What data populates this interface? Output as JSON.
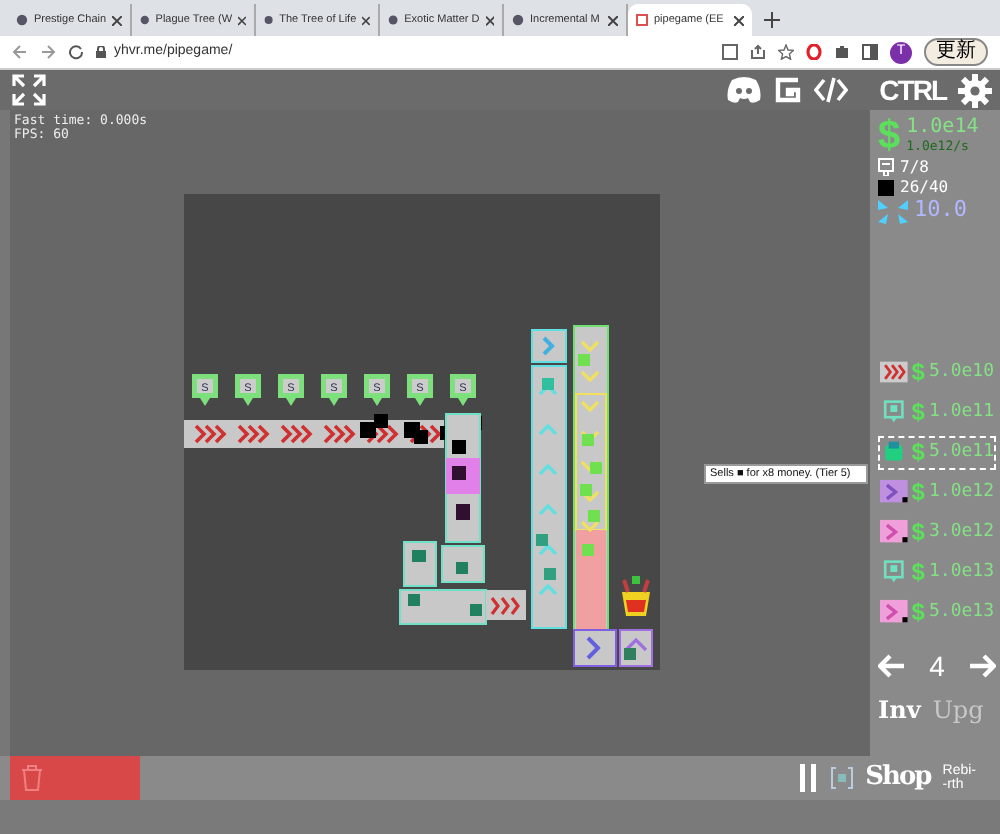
{
  "browser": {
    "tabs": [
      {
        "title": "Prestige Chain",
        "selected": false
      },
      {
        "title": "Plague Tree (W",
        "selected": false
      },
      {
        "title": "The Tree of Life",
        "selected": false
      },
      {
        "title": "Exotic Matter D",
        "selected": false
      },
      {
        "title": "Incremental M",
        "selected": false
      },
      {
        "title": "pipegame (EE",
        "selected": true
      }
    ],
    "url": "yhvr.me/pipegame/",
    "profile": "T",
    "update_button": "更新"
  },
  "topbar": {
    "ctrl_label": "CTRL"
  },
  "debug": {
    "fast_time": "Fast time: 0.000s",
    "fps": "FPS: 60"
  },
  "board": {
    "seller_labels": [
      "S",
      "S",
      "S",
      "S",
      "S",
      "S",
      "S"
    ]
  },
  "tooltip": {
    "text": "Sells ■ for x8 money. (Tier 5)"
  },
  "stats": {
    "currency": "$",
    "money": "1.0e14",
    "rate": "1.0e12/s",
    "storage": "7/8",
    "items": "26/40",
    "speed": "10.0"
  },
  "shop": {
    "items": [
      {
        "kind": "conveyor",
        "currency": "$",
        "price": "5.0e10",
        "selected": false
      },
      {
        "kind": "seller",
        "currency": "$",
        "price": "1.0e11",
        "selected": false
      },
      {
        "kind": "furnace",
        "currency": "$",
        "price": "5.0e11",
        "selected": true
      },
      {
        "kind": "turn-purple",
        "currency": "$",
        "price": "1.0e12",
        "selected": false
      },
      {
        "kind": "turn-pink",
        "currency": "$",
        "price": "3.0e12",
        "selected": false
      },
      {
        "kind": "seller",
        "currency": "$",
        "price": "1.0e13",
        "selected": false
      },
      {
        "kind": "turn-pink",
        "currency": "$",
        "price": "5.0e13",
        "selected": false
      }
    ],
    "page": "4"
  },
  "menu": [
    {
      "label": "Inv",
      "selected": true
    },
    {
      "label": "Upg",
      "selected": false
    }
  ],
  "bottom": {
    "shop_label": "Shop",
    "rebirth_lines": [
      "Rebi-",
      "-rth"
    ]
  }
}
